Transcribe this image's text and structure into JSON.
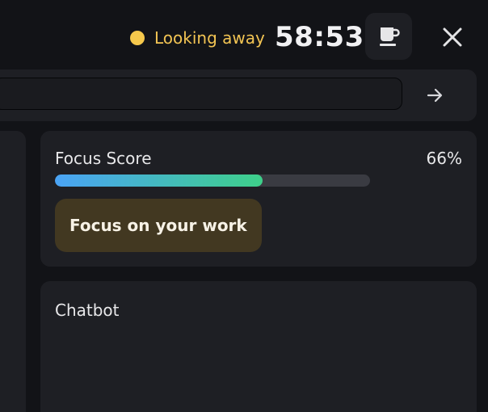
{
  "header": {
    "status_text": "Looking away",
    "status_color": "#f5c84c",
    "timer": "58:53",
    "break_icon": "coffee-cup-icon",
    "close_icon": "close-icon"
  },
  "search": {
    "value": "",
    "placeholder": "",
    "send_icon": "arrow-right-icon"
  },
  "focus": {
    "title": "Focus Score",
    "percent_label": "66%",
    "progress": 0.66,
    "message": "Focus on your work"
  },
  "chat": {
    "title": "Chatbot"
  }
}
